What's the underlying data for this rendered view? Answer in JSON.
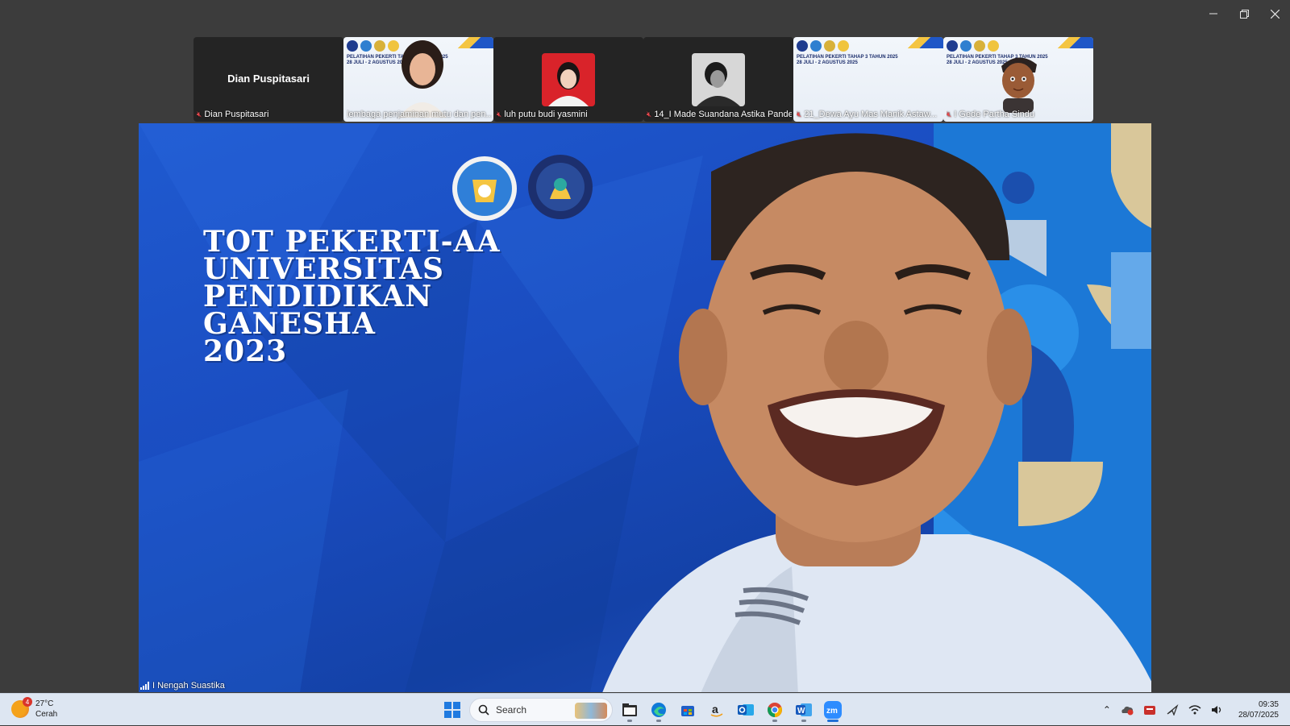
{
  "window": {
    "minimize_icon": "minimize-icon",
    "restore_icon": "restore-icon",
    "close_icon": "close-icon"
  },
  "participants": [
    {
      "tile_name": "Dian Puspitasari",
      "label": "Dian Puspitasari",
      "muted": true,
      "kind": "name-only"
    },
    {
      "label": "lembaga penjaminan mutu dan pen...",
      "muted": false,
      "kind": "video-banner"
    },
    {
      "label": "luh putu budi yasmini",
      "muted": true,
      "kind": "photo-red"
    },
    {
      "label": "14_I Made Suandana Astika Pande",
      "muted": true,
      "kind": "photo-bw"
    },
    {
      "label": "21_Dewa Ayu Mas Manik Astaw...",
      "muted": true,
      "kind": "banner"
    },
    {
      "label": "I Gede Partha Sindu",
      "muted": true,
      "kind": "avatar-banner"
    }
  ],
  "banner": {
    "line1": "PELATIHAN PEKERTI TAHAP 3 TAHUN 2025",
    "line2": "28 JULI - 2 AGUSTUS 2025"
  },
  "main_video": {
    "headline": [
      "TOT PEKERTI-AA",
      "UNIVERSITAS",
      "PENDIDIKAN",
      "GANESHA",
      "2023"
    ],
    "speaker": "I Nengah Suastika"
  },
  "taskbar": {
    "weather_temp": "27°C",
    "weather_desc": "Cerah",
    "weather_badge": "4",
    "search_placeholder": "Search",
    "apps": [
      "start-icon",
      "search-icon",
      "file-explorer-icon",
      "edge-icon",
      "store-icon",
      "amazon-icon",
      "outlook-icon",
      "chrome-icon",
      "word-icon",
      "zoom-icon"
    ],
    "time": "09:35",
    "date": "28/07/2025"
  },
  "colors": {
    "stage_blue": "#1f5ad0",
    "taskbar": "#dde6f2",
    "zoom_blue": "#2d8cff",
    "mute_red": "#e5484d"
  }
}
